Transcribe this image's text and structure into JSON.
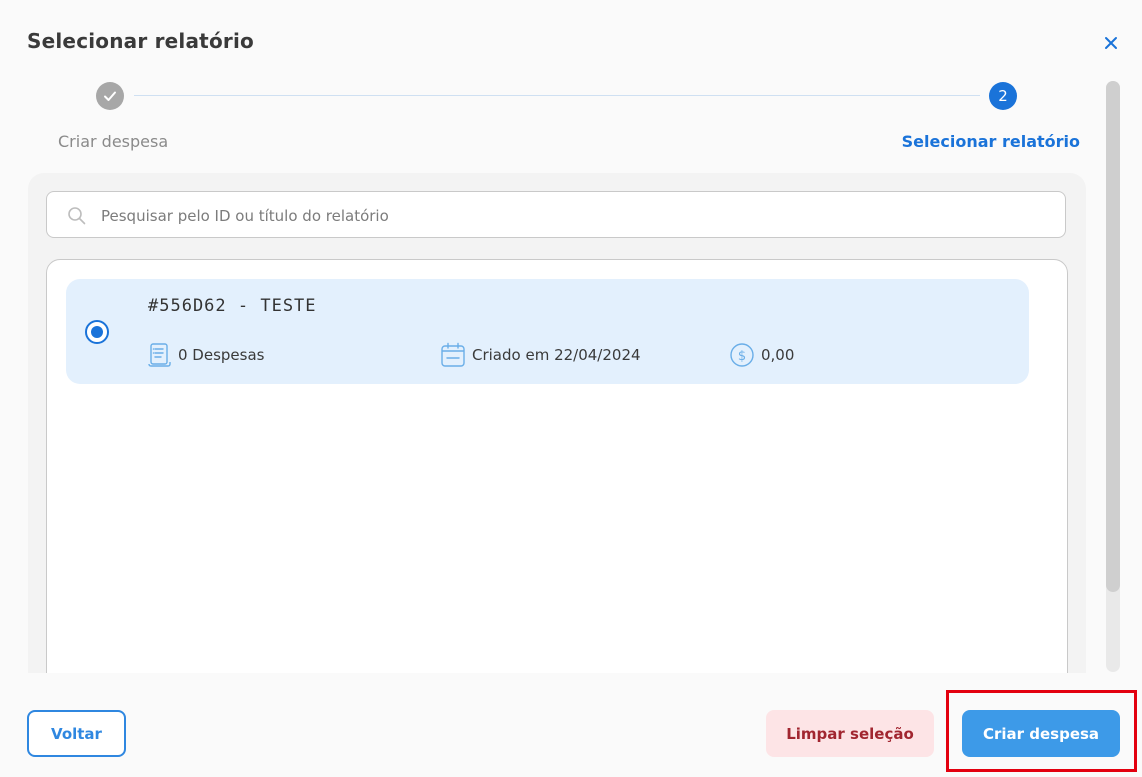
{
  "dialog": {
    "title": "Selecionar relatório"
  },
  "stepper": {
    "steps": [
      {
        "label": "Criar despesa",
        "state": "completed"
      },
      {
        "label": "Selecionar relatório",
        "number": "2",
        "state": "active"
      }
    ]
  },
  "search": {
    "placeholder": "Pesquisar pelo ID ou título do relatório",
    "value": ""
  },
  "reports": [
    {
      "title": "#556D62 - TESTE",
      "expenses": "0 Despesas",
      "created": "Criado em 22/04/2024",
      "amount": "0,00",
      "selected": true
    }
  ],
  "footer": {
    "back_label": "Voltar",
    "clear_label": "Limpar seleção",
    "create_label": "Criar despesa"
  },
  "colors": {
    "accent": "#1a73d9",
    "primary_button": "#3d9ae8",
    "clear_button_bg": "#fde4e6",
    "clear_button_text": "#a12630",
    "card_selected_bg": "#e3f0fd",
    "highlight_box": "#e3000f"
  },
  "icons": {
    "close": "close-icon",
    "check": "check-icon",
    "search": "search-icon",
    "expenses": "receipt-icon",
    "created": "calendar-icon",
    "amount": "dollar-icon"
  }
}
